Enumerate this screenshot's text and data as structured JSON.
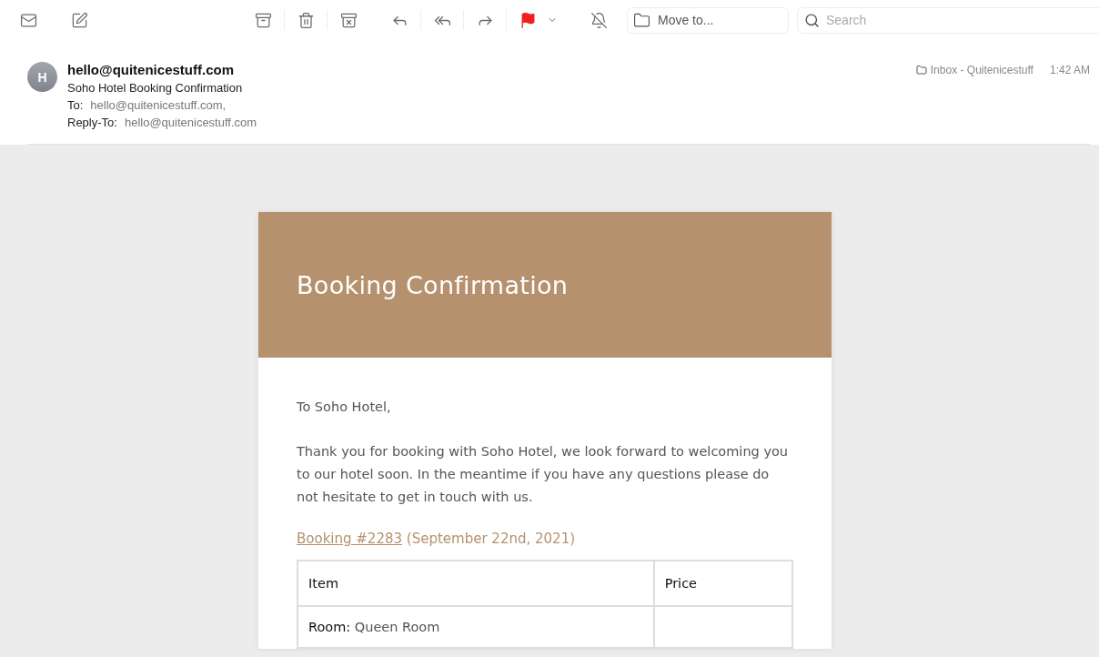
{
  "toolbar": {
    "flagged": true,
    "move_to": "Move to...",
    "search": {
      "placeholder": "Search"
    }
  },
  "message": {
    "avatar_initial": "H",
    "from": "hello@quitenicestuff.com",
    "subject": "Soho Hotel Booking Confirmation",
    "to_label": "To:",
    "to": "hello@quitenicestuff.com,",
    "reply_to_label": "Reply-To:",
    "reply_to": "hello@quitenicestuff.com",
    "mailbox": "Inbox - Quitenicestuff",
    "time": "1:42 AM"
  },
  "email": {
    "banner_title": "Booking Confirmation",
    "greeting": "To Soho Hotel,",
    "paragraph": "Thank you for booking with Soho Hotel, we look forward to welcoming you to our hotel soon. In the meantime if you have any questions please do not hesitate to get in touch with us.",
    "booking_link": "Booking #2283",
    "booking_date": "(September 22nd, 2021)",
    "table": {
      "columns": [
        "Item",
        "Price"
      ],
      "rows": [
        {
          "label": "Room:",
          "value": "Queen Room"
        }
      ]
    }
  }
}
